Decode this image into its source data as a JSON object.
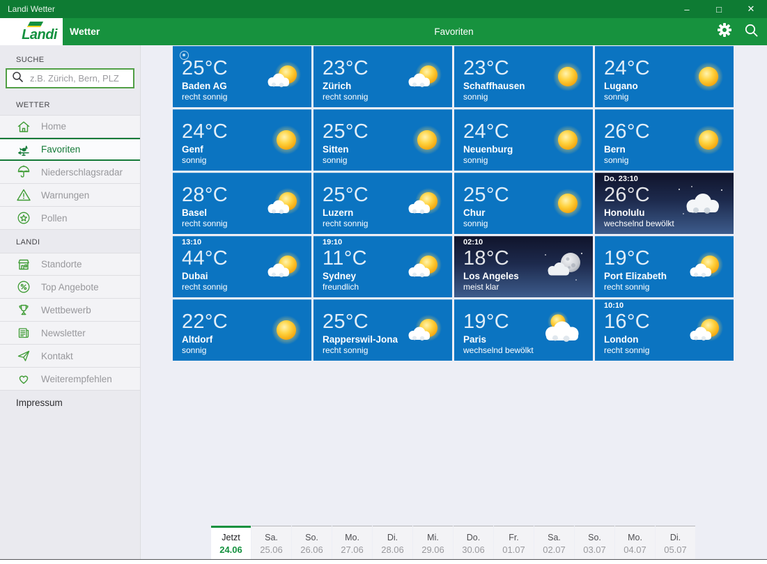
{
  "window": {
    "title": "Landi Wetter",
    "controls": {
      "minimize": "–",
      "maximize": "□",
      "close": "✕"
    }
  },
  "header": {
    "brand": "Landi",
    "app_name": "Wetter",
    "page_title": "Favoriten"
  },
  "sidebar": {
    "search_label": "SUCHE",
    "search_placeholder": "z.B. Zürich, Bern, PLZ",
    "sections": [
      {
        "label": "WETTER",
        "items": [
          {
            "label": "Home",
            "icon": "home-icon",
            "selected": false
          },
          {
            "label": "Favoriten",
            "icon": "weathervane-icon",
            "selected": true
          },
          {
            "label": "Niederschlagsradar",
            "icon": "umbrella-icon",
            "selected": false
          },
          {
            "label": "Warnungen",
            "icon": "warning-triangle-icon",
            "selected": false
          },
          {
            "label": "Pollen",
            "icon": "flower-icon",
            "selected": false
          }
        ]
      },
      {
        "label": "LANDI",
        "items": [
          {
            "label": "Standorte",
            "icon": "store-icon",
            "selected": false
          },
          {
            "label": "Top Angebote",
            "icon": "percent-badge-icon",
            "selected": false
          },
          {
            "label": "Wettbewerb",
            "icon": "trophy-icon",
            "selected": false
          },
          {
            "label": "Newsletter",
            "icon": "newsletter-icon",
            "selected": false
          },
          {
            "label": "Kontakt",
            "icon": "paper-plane-icon",
            "selected": false
          },
          {
            "label": "Weiterempfehlen",
            "icon": "heart-icon",
            "selected": false
          }
        ]
      }
    ],
    "footer_item": "Impressum"
  },
  "tiles": [
    {
      "city": "Baden AG",
      "temp": "25°C",
      "condition": "recht sonnig",
      "icon": "partly-sunny",
      "time": "",
      "night": false,
      "pinned": true
    },
    {
      "city": "Zürich",
      "temp": "23°C",
      "condition": "recht sonnig",
      "icon": "partly-sunny",
      "time": "",
      "night": false,
      "pinned": false
    },
    {
      "city": "Schaffhausen",
      "temp": "23°C",
      "condition": "sonnig",
      "icon": "sunny",
      "time": "",
      "night": false,
      "pinned": false
    },
    {
      "city": "Lugano",
      "temp": "24°C",
      "condition": "sonnig",
      "icon": "sunny",
      "time": "",
      "night": false,
      "pinned": false
    },
    {
      "city": "Genf",
      "temp": "24°C",
      "condition": "sonnig",
      "icon": "sunny",
      "time": "",
      "night": false,
      "pinned": false
    },
    {
      "city": "Sitten",
      "temp": "25°C",
      "condition": "sonnig",
      "icon": "sunny",
      "time": "",
      "night": false,
      "pinned": false
    },
    {
      "city": "Neuenburg",
      "temp": "24°C",
      "condition": "sonnig",
      "icon": "sunny",
      "time": "",
      "night": false,
      "pinned": false
    },
    {
      "city": "Bern",
      "temp": "26°C",
      "condition": "sonnig",
      "icon": "sunny",
      "time": "",
      "night": false,
      "pinned": false
    },
    {
      "city": "Basel",
      "temp": "28°C",
      "condition": "recht sonnig",
      "icon": "partly-sunny",
      "time": "",
      "night": false,
      "pinned": false
    },
    {
      "city": "Luzern",
      "temp": "25°C",
      "condition": "recht sonnig",
      "icon": "partly-sunny",
      "time": "",
      "night": false,
      "pinned": false
    },
    {
      "city": "Chur",
      "temp": "25°C",
      "condition": "sonnig",
      "icon": "sunny",
      "time": "",
      "night": false,
      "pinned": false
    },
    {
      "city": "Honolulu",
      "temp": "26°C",
      "condition": "wechselnd bewölkt",
      "icon": "night-cloudy",
      "time": "Do. 23:10",
      "night": true,
      "pinned": false
    },
    {
      "city": "Dubai",
      "temp": "44°C",
      "condition": "recht sonnig",
      "icon": "partly-sunny",
      "time": "13:10",
      "night": false,
      "pinned": false
    },
    {
      "city": "Sydney",
      "temp": "11°C",
      "condition": "freundlich",
      "icon": "partly-sunny",
      "time": "19:10",
      "night": false,
      "pinned": false
    },
    {
      "city": "Los Angeles",
      "temp": "18°C",
      "condition": "meist klar",
      "icon": "night-moon-cloud",
      "time": "02:10",
      "night": true,
      "pinned": false
    },
    {
      "city": "Port Elizabeth",
      "temp": "19°C",
      "condition": "recht sonnig",
      "icon": "partly-sunny",
      "time": "",
      "night": false,
      "pinned": false
    },
    {
      "city": "Altdorf",
      "temp": "22°C",
      "condition": "sonnig",
      "icon": "sunny",
      "time": "",
      "night": false,
      "pinned": false
    },
    {
      "city": "Rapperswil-Jona",
      "temp": "25°C",
      "condition": "recht sonnig",
      "icon": "partly-sunny",
      "time": "",
      "night": false,
      "pinned": false
    },
    {
      "city": "Paris",
      "temp": "19°C",
      "condition": "wechselnd bewölkt",
      "icon": "mostly-cloudy",
      "time": "",
      "night": false,
      "pinned": false
    },
    {
      "city": "London",
      "temp": "16°C",
      "condition": "recht sonnig",
      "icon": "partly-sunny",
      "time": "10:10",
      "night": false,
      "pinned": false
    }
  ],
  "day_tabs": [
    {
      "day": "Jetzt",
      "date": "24.06",
      "selected": true
    },
    {
      "day": "Sa.",
      "date": "25.06",
      "selected": false
    },
    {
      "day": "So.",
      "date": "26.06",
      "selected": false
    },
    {
      "day": "Mo.",
      "date": "27.06",
      "selected": false
    },
    {
      "day": "Di.",
      "date": "28.06",
      "selected": false
    },
    {
      "day": "Mi.",
      "date": "29.06",
      "selected": false
    },
    {
      "day": "Do.",
      "date": "30.06",
      "selected": false
    },
    {
      "day": "Fr.",
      "date": "01.07",
      "selected": false
    },
    {
      "day": "Sa.",
      "date": "02.07",
      "selected": false
    },
    {
      "day": "So.",
      "date": "03.07",
      "selected": false
    },
    {
      "day": "Mo.",
      "date": "04.07",
      "selected": false
    },
    {
      "day": "Di.",
      "date": "05.07",
      "selected": false
    }
  ],
  "colors": {
    "titlebar_green": "#0E7B33",
    "header_green": "#17923E",
    "brand_green": "#13913F",
    "icon_green": "#3F9C35",
    "selected_green": "#157A38",
    "tile_blue": "#0B74C1",
    "night_top": "#10142B",
    "night_bottom": "#3D5C8C"
  }
}
